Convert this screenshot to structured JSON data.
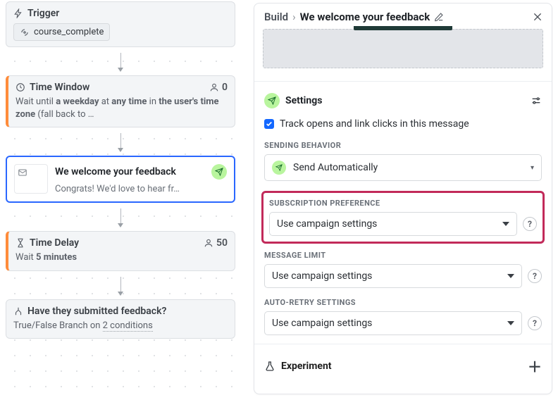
{
  "canvas": {
    "trigger": {
      "label": "Trigger",
      "pill": "course_complete"
    },
    "window": {
      "title": "Time Window",
      "count": "0",
      "desc_prefix": "Wait until ",
      "desc_b1": "a weekday",
      "desc_mid1": " at ",
      "desc_b2": "any time",
      "desc_mid2": " in ",
      "desc_b3": "the user's time zone",
      "desc_suffix": " (fall back to …"
    },
    "message": {
      "title": "We welcome your feedback",
      "preview": "Congrats! We'd love to hear fr…"
    },
    "delay": {
      "title": "Time Delay",
      "count": "50",
      "desc_prefix": "Wait ",
      "desc_b1": "5 minutes"
    },
    "branch": {
      "title": "Have they submitted feedback?",
      "desc_prefix": "True/False Branch on ",
      "desc_link": "2 conditions"
    }
  },
  "panel": {
    "crumb": "Build",
    "title": "We welcome your feedback",
    "settings_label": "Settings",
    "track_label": "Track opens and link clicks in this message",
    "sending": {
      "label": "SENDING BEHAVIOR",
      "value": "Send Automatically"
    },
    "subscription": {
      "label": "SUBSCRIPTION PREFERENCE",
      "value": "Use campaign settings"
    },
    "limit": {
      "label": "MESSAGE LIMIT",
      "value": "Use campaign settings"
    },
    "retry": {
      "label": "AUTO-RETRY SETTINGS",
      "value": "Use campaign settings"
    },
    "experiment": "Experiment"
  }
}
